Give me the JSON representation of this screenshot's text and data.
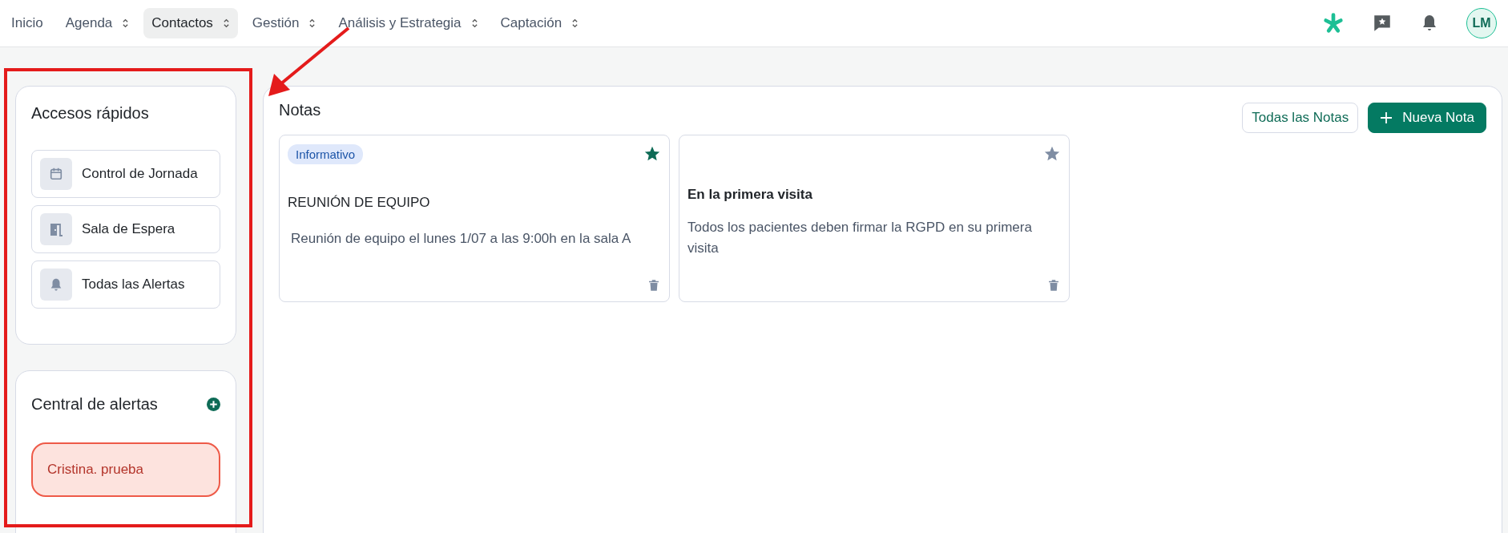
{
  "nav": {
    "items": [
      {
        "label": "Inicio",
        "selected": false,
        "dropdown": false
      },
      {
        "label": "Agenda",
        "selected": false,
        "dropdown": true
      },
      {
        "label": "Contactos",
        "selected": true,
        "dropdown": true
      },
      {
        "label": "Gestión",
        "selected": false,
        "dropdown": true
      },
      {
        "label": "Análisis y Estrategia",
        "selected": false,
        "dropdown": true
      },
      {
        "label": "Captación",
        "selected": false,
        "dropdown": true
      }
    ],
    "avatar": "LM"
  },
  "quick_access": {
    "title": "Accesos rápidos",
    "items": [
      {
        "label": "Control de Jornada",
        "kind": "calendar"
      },
      {
        "label": "Sala de Espera",
        "kind": "door"
      },
      {
        "label": "Todas las Alertas",
        "kind": "bell"
      }
    ]
  },
  "alerts": {
    "title": "Central de alertas",
    "items": [
      {
        "label": "Cristina. prueba"
      }
    ]
  },
  "notes": {
    "title": "Notas",
    "all_button": "Todas las Notas",
    "new_button": "Nueva Nota",
    "items": [
      {
        "tag": "Informativo",
        "favorite": true,
        "title": "REUNIÓN DE EQUIPO",
        "body": "Reunión de equipo el lunes 1/07 a las 9:00h en la sala A"
      },
      {
        "favorite": false,
        "title": "En la primera visita",
        "body": "Todos los pacientes deben firmar la RGPD en su primera visita"
      }
    ]
  }
}
